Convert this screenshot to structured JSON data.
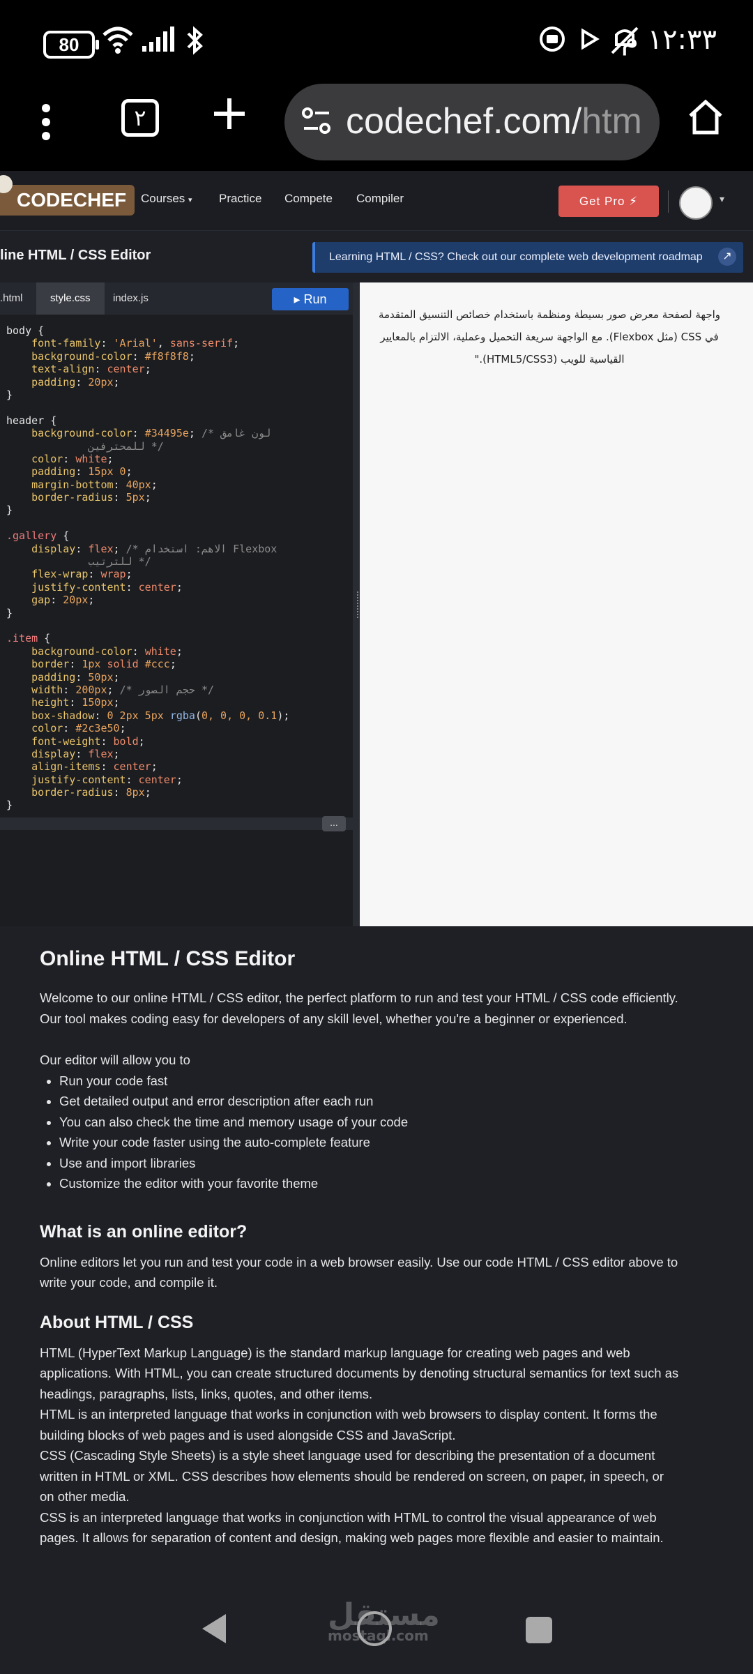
{
  "status_bar": {
    "battery": "80",
    "time": "١٢:٣٣ م"
  },
  "browser": {
    "tab_count": "٢",
    "url_main": "codechef.com/",
    "url_dim": "htm"
  },
  "site_header": {
    "logo": "CODECHEF",
    "nav": [
      "Courses",
      "Practice",
      "Compete",
      "Compiler"
    ],
    "get_pro": "Get Pro ⚡"
  },
  "editor_bar": {
    "title": "line HTML / CSS Editor",
    "roadmap_banner": "Learning HTML / CSS? Check out our complete web development roadmap"
  },
  "editor": {
    "tabs": [
      ".html",
      "style.css",
      "index.js"
    ],
    "active_tab": "style.css",
    "run_label": "Run",
    "more_label": "..."
  },
  "preview": {
    "text": "واجهة لصفحة معرض صور بسيطة ومنظمة باستخدام خصائص التنسيق المتقدمة في CSS (مثل Flexbox). مع الواجهة سريعة التحميل وعملية، الالتزام بالمعايير القياسية للويب (HTML5/CSS3).\""
  },
  "content": {
    "h1": "Online HTML / CSS Editor",
    "intro": "Welcome to our online HTML / CSS editor, the perfect platform to run and test your HTML / CSS code efficiently. Our tool makes coding easy for developers of any skill level, whether you're a beginner or experienced.",
    "list_intro": "Our editor will allow you to",
    "features": [
      "Run your code fast",
      "Get detailed output and error description after each run",
      "You can also check the time and memory usage of your code",
      "Write your code faster using the auto-complete feature",
      "Use and import libraries",
      "Customize the editor with your favorite theme"
    ],
    "h2_online": "What is an online editor?",
    "online_text": "Online editors let you run and test your code in a web browser easily. Use our code HTML / CSS editor above to write your code, and compile it.",
    "h2_about": "About HTML / CSS",
    "about": [
      "HTML (HyperText Markup Language) is the standard markup language for creating web pages and web applications. With HTML, you can create structured documents by denoting structural semantics for text such as headings, paragraphs, lists, links, quotes, and other items.",
      "HTML is an interpreted language that works in conjunction with web browsers to display content. It forms the building blocks of web pages and is used alongside CSS and JavaScript.",
      "CSS (Cascading Style Sheets) is a style sheet language used for describing the presentation of a document written in HTML or XML. CSS describes how elements should be rendered on screen, on paper, in speech, or on other media.",
      "CSS is an interpreted language that works in conjunction with HTML to control the visual appearance of web pages. It allows for separation of content and design, making web pages more flexible and easier to maintain."
    ]
  },
  "watermark": {
    "arabic": "مستقل",
    "latin": "mostaql.com"
  }
}
